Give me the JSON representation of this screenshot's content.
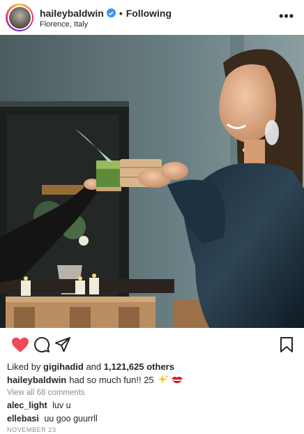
{
  "post": {
    "username": "haileybaldwin",
    "separator": "•",
    "follow_status": "Following",
    "location": "Florence, Italy",
    "more_icon": "more-horizontal-icon",
    "photo_alt": ""
  },
  "actions": {
    "like_icon": "heart-icon",
    "comment_icon": "comment-icon",
    "share_icon": "send-icon",
    "save_icon": "bookmark-icon",
    "liked": true
  },
  "likes": {
    "prefix": "Liked by",
    "liked_by_user": "gigihadid",
    "connector": "and",
    "count": "1,121,625 others"
  },
  "caption": {
    "username": "haileybaldwin",
    "text": "had so much fun!! 25"
  },
  "comments": {
    "view_all": "View all 68 comments",
    "items": [
      {
        "username": "alec_light",
        "text": "luv u"
      },
      {
        "username": "ellebasi",
        "text": "uu goo guurrll"
      }
    ]
  },
  "date": "NOVEMBER 23",
  "colors": {
    "like_red": "#ed4956",
    "verified_blue": "#3897f0",
    "muted_gray": "#8e8e8e",
    "text": "#262626"
  }
}
